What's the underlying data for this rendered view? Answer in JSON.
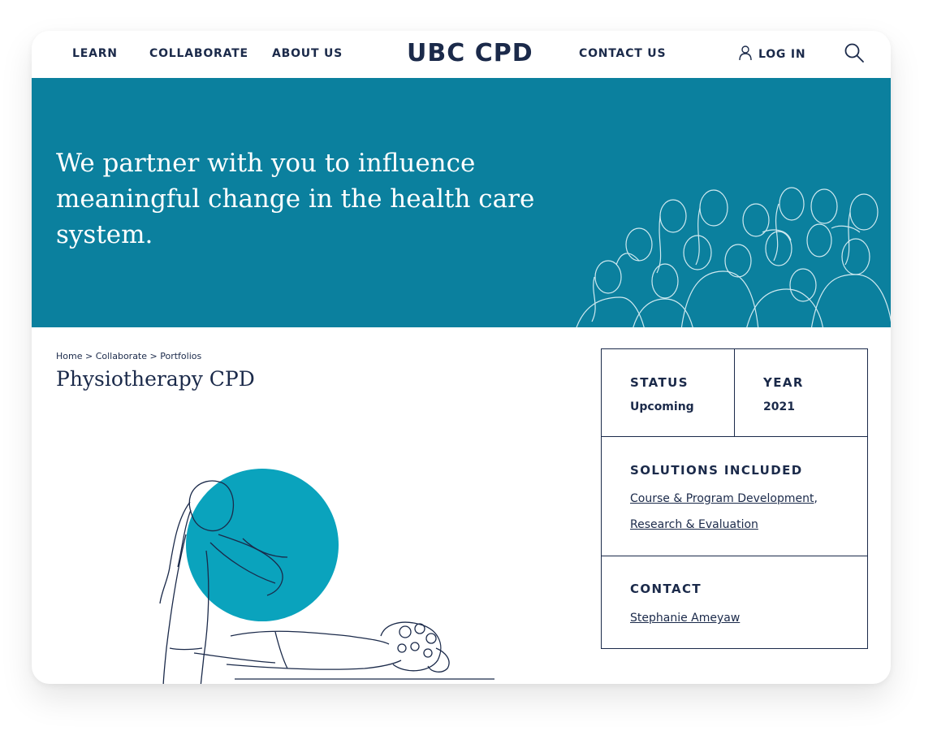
{
  "nav": {
    "learn": "LEARN",
    "collaborate": "COLLABORATE",
    "about": "ABOUT US",
    "brand": "UBC CPD",
    "contact": "CONTACT US",
    "login": "LOG IN"
  },
  "hero": {
    "headline": "We partner with you to influence meaningful change in the health care system."
  },
  "breadcrumb": "Home > Collaborate > Portfolios",
  "page_title": "Physiotherapy CPD",
  "info": {
    "status_label": "STATUS",
    "status_value": "Upcoming",
    "year_label": "YEAR",
    "year_value": "2021",
    "solutions_label": "SOLUTIONS INCLUDED",
    "solution_1": "Course & Program Development",
    "solution_sep": ",",
    "solution_2": "Research & Evaluation",
    "contact_label": "CONTACT",
    "contact_name": "Stephanie Ameyaw"
  },
  "colors": {
    "hero_bg": "#0b809e",
    "accent_circle": "#0aa3bd",
    "text_navy": "#1b2a4a"
  },
  "icons": {
    "user": "user-icon",
    "search": "search-icon"
  }
}
